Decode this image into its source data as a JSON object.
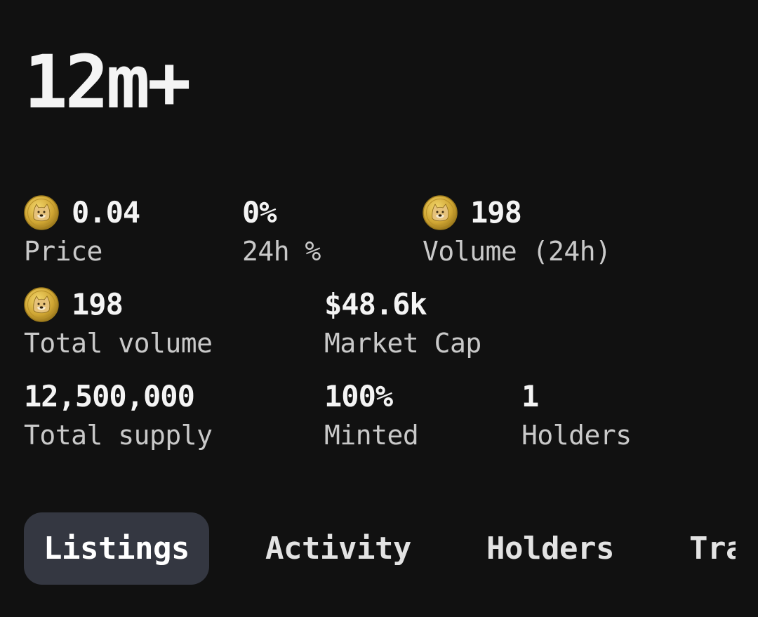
{
  "token": {
    "title": "12m+"
  },
  "stats": {
    "price": {
      "value": "0.04",
      "label": "Price",
      "icon": "doge-coin-icon"
    },
    "change_24h": {
      "value": "0%",
      "label": "24h %"
    },
    "volume_24h": {
      "value": "198",
      "label": "Volume (24h)",
      "icon": "doge-coin-icon"
    },
    "total_volume": {
      "value": "198",
      "label": "Total volume",
      "icon": "doge-coin-icon"
    },
    "market_cap": {
      "value": "$48.6k",
      "label": "Market Cap"
    },
    "total_supply": {
      "value": "12,500,000",
      "label": "Total supply"
    },
    "minted": {
      "value": "100%",
      "label": "Minted"
    },
    "holders": {
      "value": "1",
      "label": "Holders"
    }
  },
  "tabs": {
    "active": "Listings",
    "items": [
      {
        "label": "Listings"
      },
      {
        "label": "Activity"
      },
      {
        "label": "Holders"
      },
      {
        "label": "Tra"
      }
    ]
  },
  "colors": {
    "background": "#111111",
    "active_tab": "#343741",
    "coin_gold": "#d4b03a"
  }
}
